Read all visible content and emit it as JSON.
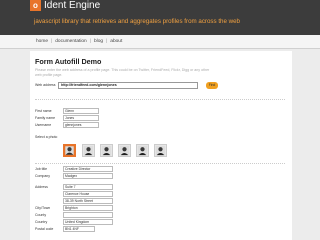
{
  "header": {
    "logo_glyph": "o",
    "app_name": "Ident Engine",
    "tagline": "javascript library that retrieves and aggregates profiles from across the web"
  },
  "nav": {
    "items": [
      "home",
      "documentation",
      "blog",
      "about"
    ]
  },
  "main": {
    "title": "Form Autofill Demo",
    "intro": "Please enter the web address of a profile page. This could be on Twitter, FriendFeed, Flickr, Digg or any other web profile page.",
    "web_address_label": "Web address",
    "web_address_value": "http://friendfeed.com/glennjones",
    "find_button_label": "Find",
    "fields": {
      "first_name": {
        "label": "First name",
        "value": "Glenn"
      },
      "family_name": {
        "label": "Family name",
        "value": "Jones"
      },
      "username": {
        "label": "Username",
        "value": "glennjones"
      }
    },
    "photo_label": "Select a photo",
    "photos": [
      "photo-1",
      "photo-2",
      "photo-3",
      "photo-4",
      "photo-5",
      "photo-6"
    ],
    "job": {
      "job_title": {
        "label": "Job title",
        "value": "Creative Director"
      },
      "company": {
        "label": "Company",
        "value": "Madgex"
      }
    },
    "address": {
      "address": {
        "label": "Address",
        "lines": [
          "Suite 7",
          "Clarence House",
          "38-39 North Street"
        ]
      },
      "city": {
        "label": "City/Town",
        "value": "Brighton"
      },
      "county": {
        "label": "County",
        "value": ""
      },
      "country": {
        "label": "Country",
        "value": "United Kingdom"
      },
      "postal_code": {
        "label": "Postal code",
        "value": "BN1 4NF"
      }
    }
  },
  "colors": {
    "header_bg": "#3c3c3c",
    "accent_orange": "#e8742a",
    "tagline": "#f0a040",
    "find_button": "#f0a020"
  }
}
